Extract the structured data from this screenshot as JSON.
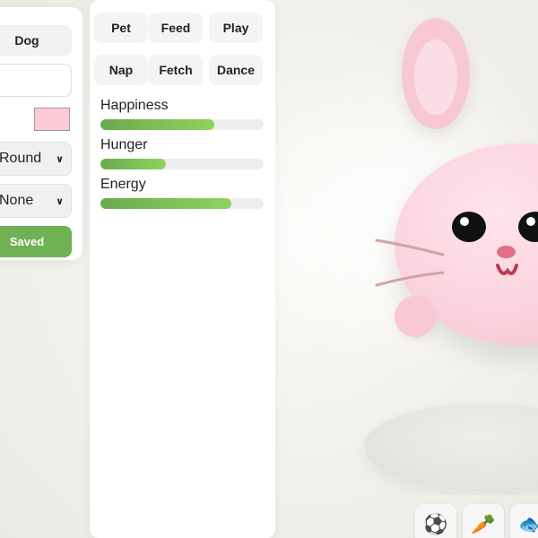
{
  "customize": {
    "pet_type": "Dog",
    "name_value": "",
    "body_color": "#ffcad8",
    "shape": "Round",
    "accessory": "None",
    "save_label": "Saved"
  },
  "actions": {
    "buttons": [
      "Pet",
      "Feed",
      "Play",
      "Nap",
      "Fetch",
      "Dance"
    ]
  },
  "stats": [
    {
      "label": "Happiness",
      "value": 0.7
    },
    {
      "label": "Hunger",
      "value": 0.4
    },
    {
      "label": "Energy",
      "value": 0.8
    }
  ],
  "toys": [
    {
      "icon": "soccer-ball-icon",
      "glyph": "⚽"
    },
    {
      "icon": "carrot-icon",
      "glyph": "🥕"
    },
    {
      "icon": "fish-icon",
      "glyph": "🐟"
    }
  ],
  "colors": {
    "accent_green": "#6fb153",
    "pet_pink": "#fad2dd"
  }
}
